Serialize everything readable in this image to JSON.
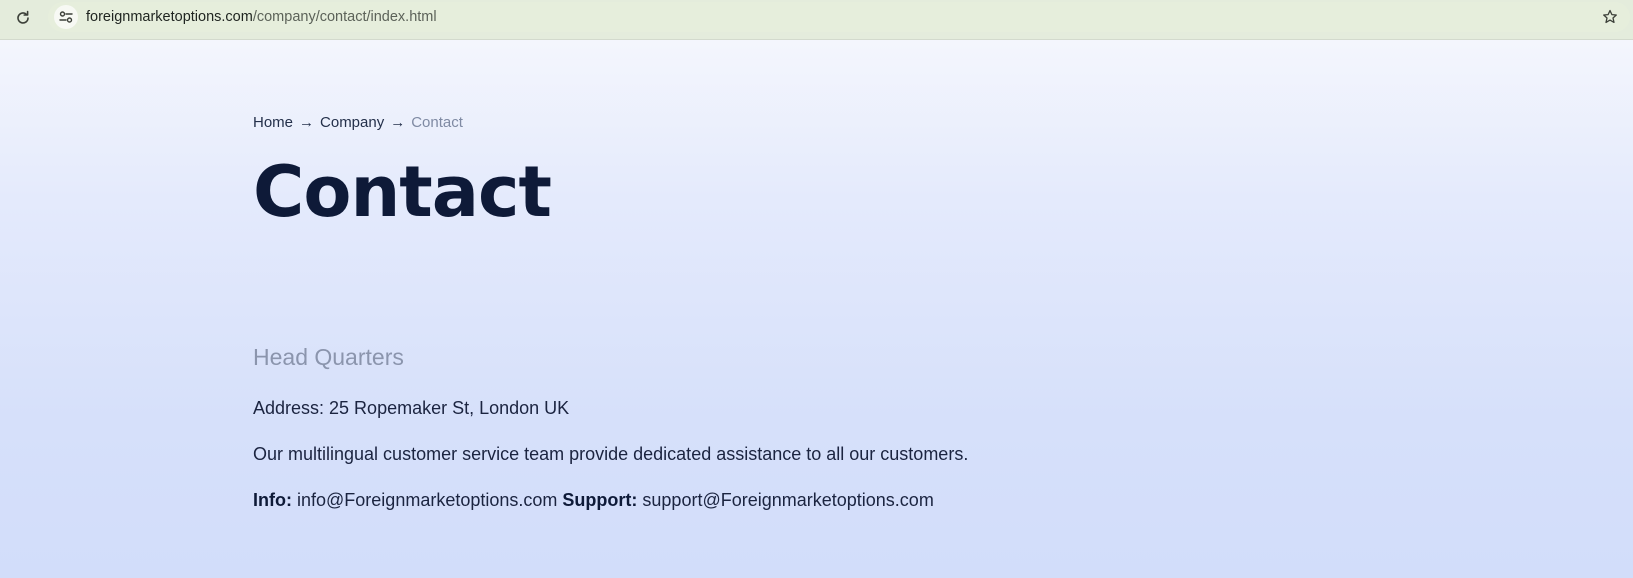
{
  "browser": {
    "url_host": "foreignmarketoptions.com",
    "url_path": "/company/contact/index.html"
  },
  "breadcrumb": {
    "items": [
      "Home",
      "Company"
    ],
    "separator": "→",
    "current": "Contact"
  },
  "page": {
    "title": "Contact"
  },
  "headquarters": {
    "heading": "Head Quarters",
    "address": "Address: 25 Ropemaker St, London UK",
    "description": "Our multilingual customer service team provide dedicated assistance to all our customers.",
    "info_label": "Info:",
    "info_email": "info@Foreignmarketoptions.com",
    "support_label": "Support:",
    "support_email": "support@Foreignmarketoptions.com"
  },
  "colors": {
    "title": "#0e1a38",
    "muted_heading": "#8b95ad",
    "breadcrumb_current": "#7f8aa3",
    "background_top": "#f4f6fd",
    "background_bottom": "#d2ddfa"
  },
  "icons": {
    "reload": "reload-icon",
    "site_info": "tune-icon",
    "bookmark": "star-icon"
  }
}
